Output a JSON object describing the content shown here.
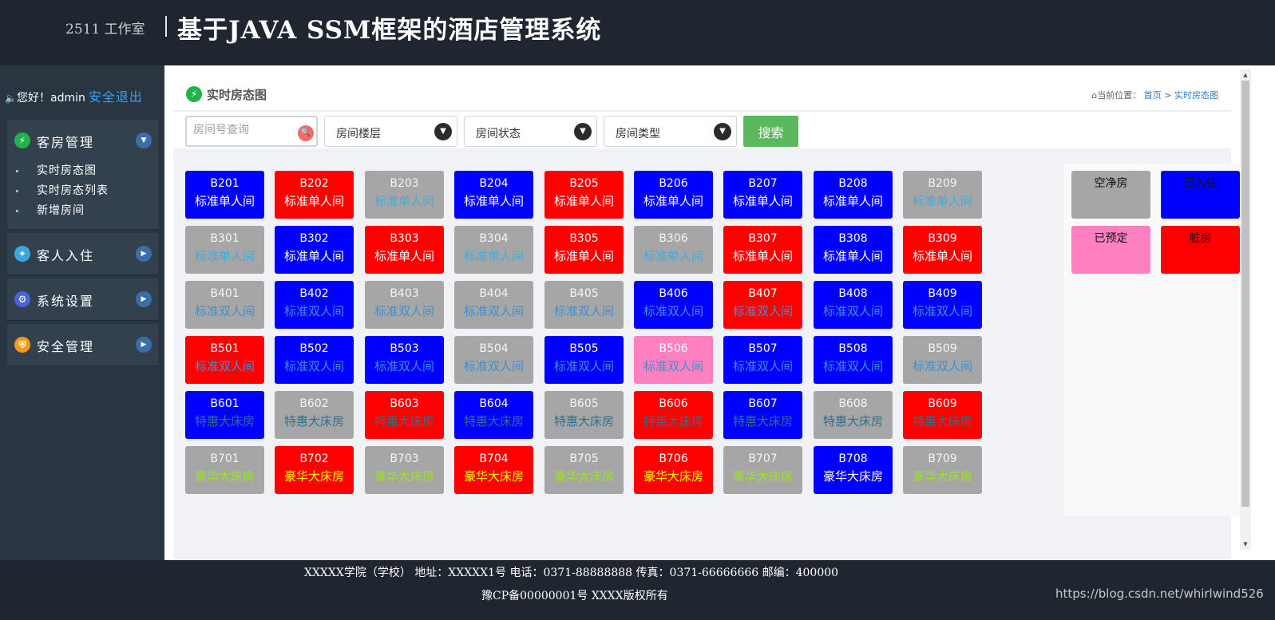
{
  "header": {
    "studio": "2511 工作室",
    "title": "基于JAVA SSM框架的酒店管理系统"
  },
  "sidebar": {
    "welcome": "您好！admin",
    "logout": "安全退出",
    "menu": [
      {
        "label": "客房管理",
        "icon": "lightning-icon",
        "icon_color": "#21b24b",
        "expanded": true,
        "items": [
          "实时房态图",
          "实时房态列表",
          "新增房间"
        ]
      },
      {
        "label": "客人入住",
        "icon": "lightbulb-icon",
        "icon_color": "#39a8e0",
        "expanded": false,
        "items": []
      },
      {
        "label": "系统设置",
        "icon": "gears-icon",
        "icon_color": "#4a63d8",
        "expanded": false,
        "items": []
      },
      {
        "label": "安全管理",
        "icon": "shield-icon",
        "icon_color": "#f09a20",
        "expanded": false,
        "items": []
      }
    ]
  },
  "panel": {
    "title": "实时房态图",
    "breadcrumb_prefix": "当前位置：",
    "breadcrumb_home": "首页",
    "breadcrumb_sep": ">",
    "breadcrumb_current": "实时房态图"
  },
  "filters": {
    "search_placeholder": "房间号查询",
    "floor": "房间楼层",
    "status": "房间状态",
    "type": "房间类型",
    "search_button": "搜索"
  },
  "status_colors": {
    "clean": "#a6a6a6",
    "occupied": "#0000ff",
    "reserved": "#ff80c0",
    "dirty": "#ff0000"
  },
  "rooms": [
    {
      "number": "B201",
      "type": "标准单人间",
      "status": "occupied"
    },
    {
      "number": "B202",
      "type": "标准单人间",
      "status": "dirty"
    },
    {
      "number": "B203",
      "type": "标准单人间",
      "status": "clean"
    },
    {
      "number": "B204",
      "type": "标准单人间",
      "status": "occupied"
    },
    {
      "number": "B205",
      "type": "标准单人间",
      "status": "dirty"
    },
    {
      "number": "B206",
      "type": "标准单人间",
      "status": "occupied"
    },
    {
      "number": "B207",
      "type": "标准单人间",
      "status": "occupied"
    },
    {
      "number": "B208",
      "type": "标准单人间",
      "status": "occupied"
    },
    {
      "number": "B209",
      "type": "标准单人间",
      "status": "clean"
    },
    {
      "number": "B301",
      "type": "标准单人间",
      "status": "clean"
    },
    {
      "number": "B302",
      "type": "标准单人间",
      "status": "occupied"
    },
    {
      "number": "B303",
      "type": "标准单人间",
      "status": "dirty"
    },
    {
      "number": "B304",
      "type": "标准单人间",
      "status": "clean"
    },
    {
      "number": "B305",
      "type": "标准单人间",
      "status": "dirty"
    },
    {
      "number": "B306",
      "type": "标准单人间",
      "status": "clean"
    },
    {
      "number": "B307",
      "type": "标准单人间",
      "status": "dirty"
    },
    {
      "number": "B308",
      "type": "标准单人间",
      "status": "occupied"
    },
    {
      "number": "B309",
      "type": "标准单人间",
      "status": "dirty"
    },
    {
      "number": "B401",
      "type": "标准双人间",
      "status": "clean"
    },
    {
      "number": "B402",
      "type": "标准双人间",
      "status": "occupied"
    },
    {
      "number": "B403",
      "type": "标准双人间",
      "status": "clean"
    },
    {
      "number": "B404",
      "type": "标准双人间",
      "status": "clean"
    },
    {
      "number": "B405",
      "type": "标准双人间",
      "status": "clean"
    },
    {
      "number": "B406",
      "type": "标准双人间",
      "status": "occupied"
    },
    {
      "number": "B407",
      "type": "标准双人间",
      "status": "dirty"
    },
    {
      "number": "B408",
      "type": "标准双人间",
      "status": "occupied"
    },
    {
      "number": "B409",
      "type": "标准双人间",
      "status": "occupied"
    },
    {
      "number": "B501",
      "type": "标准双人间",
      "status": "dirty"
    },
    {
      "number": "B502",
      "type": "标准双人间",
      "status": "occupied"
    },
    {
      "number": "B503",
      "type": "标准双人间",
      "status": "occupied"
    },
    {
      "number": "B504",
      "type": "标准双人间",
      "status": "clean"
    },
    {
      "number": "B505",
      "type": "标准双人间",
      "status": "occupied"
    },
    {
      "number": "B506",
      "type": "标准双人间",
      "status": "reserved"
    },
    {
      "number": "B507",
      "type": "标准双人间",
      "status": "occupied"
    },
    {
      "number": "B508",
      "type": "标准双人间",
      "status": "occupied"
    },
    {
      "number": "B509",
      "type": "标准双人间",
      "status": "clean"
    },
    {
      "number": "B601",
      "type": "特惠大床房",
      "status": "occupied"
    },
    {
      "number": "B602",
      "type": "特惠大床房",
      "status": "clean"
    },
    {
      "number": "B603",
      "type": "特惠大床房",
      "status": "dirty"
    },
    {
      "number": "B604",
      "type": "特惠大床房",
      "status": "occupied"
    },
    {
      "number": "B605",
      "type": "特惠大床房",
      "status": "clean"
    },
    {
      "number": "B606",
      "type": "特惠大床房",
      "status": "dirty"
    },
    {
      "number": "B607",
      "type": "特惠大床房",
      "status": "occupied"
    },
    {
      "number": "B608",
      "type": "特惠大床房",
      "status": "clean"
    },
    {
      "number": "B609",
      "type": "特惠大床房",
      "status": "dirty"
    },
    {
      "number": "B701",
      "type": "豪华大床房",
      "status": "clean"
    },
    {
      "number": "B702",
      "type": "豪华大床房",
      "status": "dirty"
    },
    {
      "number": "B703",
      "type": "豪华大床房",
      "status": "clean"
    },
    {
      "number": "B704",
      "type": "豪华大床房",
      "status": "dirty"
    },
    {
      "number": "B705",
      "type": "豪华大床房",
      "status": "clean"
    },
    {
      "number": "B706",
      "type": "豪华大床房",
      "status": "dirty"
    },
    {
      "number": "B707",
      "type": "豪华大床房",
      "status": "clean"
    },
    {
      "number": "B708",
      "type": "豪华大床房",
      "status": "occupied"
    },
    {
      "number": "B709",
      "type": "豪华大床房",
      "status": "clean"
    }
  ],
  "type_text_colors": {
    "标准单人间": "#45a9d9",
    "标准双人间": "#3f8fd0",
    "特惠大床房": "#2f6f8f",
    "豪华大床房": "#9be22b"
  },
  "legend": [
    {
      "label": "空净房",
      "status": "clean"
    },
    {
      "label": "已入住",
      "status": "occupied"
    },
    {
      "label": "已预定",
      "status": "reserved"
    },
    {
      "label": "脏房",
      "status": "dirty"
    }
  ],
  "footer": {
    "line1": "XXXXX学院（学校） 地址：XXXXX1号 电话：0371-88888888 传真：0371-66666666 邮编：400000",
    "line2": "豫CP备00000001号 XXXX版权所有",
    "watermark": "https://blog.csdn.net/whirlwind526"
  }
}
